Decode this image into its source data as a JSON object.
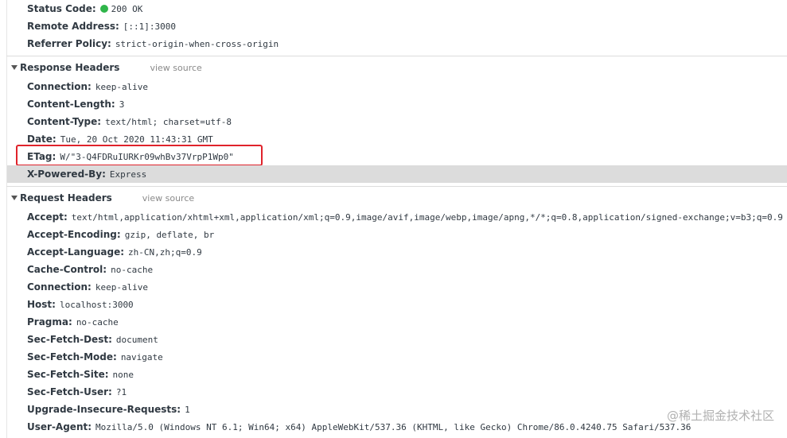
{
  "general": [
    {
      "key": "Status Code:",
      "value": "200 OK"
    },
    {
      "key": "Remote Address:",
      "value": "[::1]:3000"
    },
    {
      "key": "Referrer Policy:",
      "value": "strict-origin-when-cross-origin"
    }
  ],
  "response_headers": {
    "title": "Response Headers",
    "view_source": "view source",
    "items": [
      {
        "key": "Connection:",
        "value": "keep-alive"
      },
      {
        "key": "Content-Length:",
        "value": "3"
      },
      {
        "key": "Content-Type:",
        "value": "text/html; charset=utf-8"
      },
      {
        "key": "Date:",
        "value": "Tue, 20 Oct 2020 11:43:31 GMT"
      },
      {
        "key": "ETag:",
        "value": "W/\"3-Q4FDRuIURKr09whBv37VrpP1Wp0\""
      },
      {
        "key": "X-Powered-By:",
        "value": "Express"
      }
    ]
  },
  "request_headers": {
    "title": "Request Headers",
    "view_source": "view source",
    "items": [
      {
        "key": "Accept:",
        "value": "text/html,application/xhtml+xml,application/xml;q=0.9,image/avif,image/webp,image/apng,*/*;q=0.8,application/signed-exchange;v=b3;q=0.9"
      },
      {
        "key": "Accept-Encoding:",
        "value": "gzip, deflate, br"
      },
      {
        "key": "Accept-Language:",
        "value": "zh-CN,zh;q=0.9"
      },
      {
        "key": "Cache-Control:",
        "value": "no-cache"
      },
      {
        "key": "Connection:",
        "value": "keep-alive"
      },
      {
        "key": "Host:",
        "value": "localhost:3000"
      },
      {
        "key": "Pragma:",
        "value": "no-cache"
      },
      {
        "key": "Sec-Fetch-Dest:",
        "value": "document"
      },
      {
        "key": "Sec-Fetch-Mode:",
        "value": "navigate"
      },
      {
        "key": "Sec-Fetch-Site:",
        "value": "none"
      },
      {
        "key": "Sec-Fetch-User:",
        "value": "?1"
      },
      {
        "key": "Upgrade-Insecure-Requests:",
        "value": "1"
      },
      {
        "key": "User-Agent:",
        "value": "Mozilla/5.0 (Windows NT 6.1; Win64; x64) AppleWebKit/537.36 (KHTML, like Gecko) Chrome/86.0.4240.75 Safari/537.36"
      }
    ]
  },
  "watermark": "@稀土掘金技术社区",
  "colors": {
    "status_ok": "#2fb54a",
    "callout": "#e0232b",
    "highlight_row": "#dcdcdc"
  }
}
